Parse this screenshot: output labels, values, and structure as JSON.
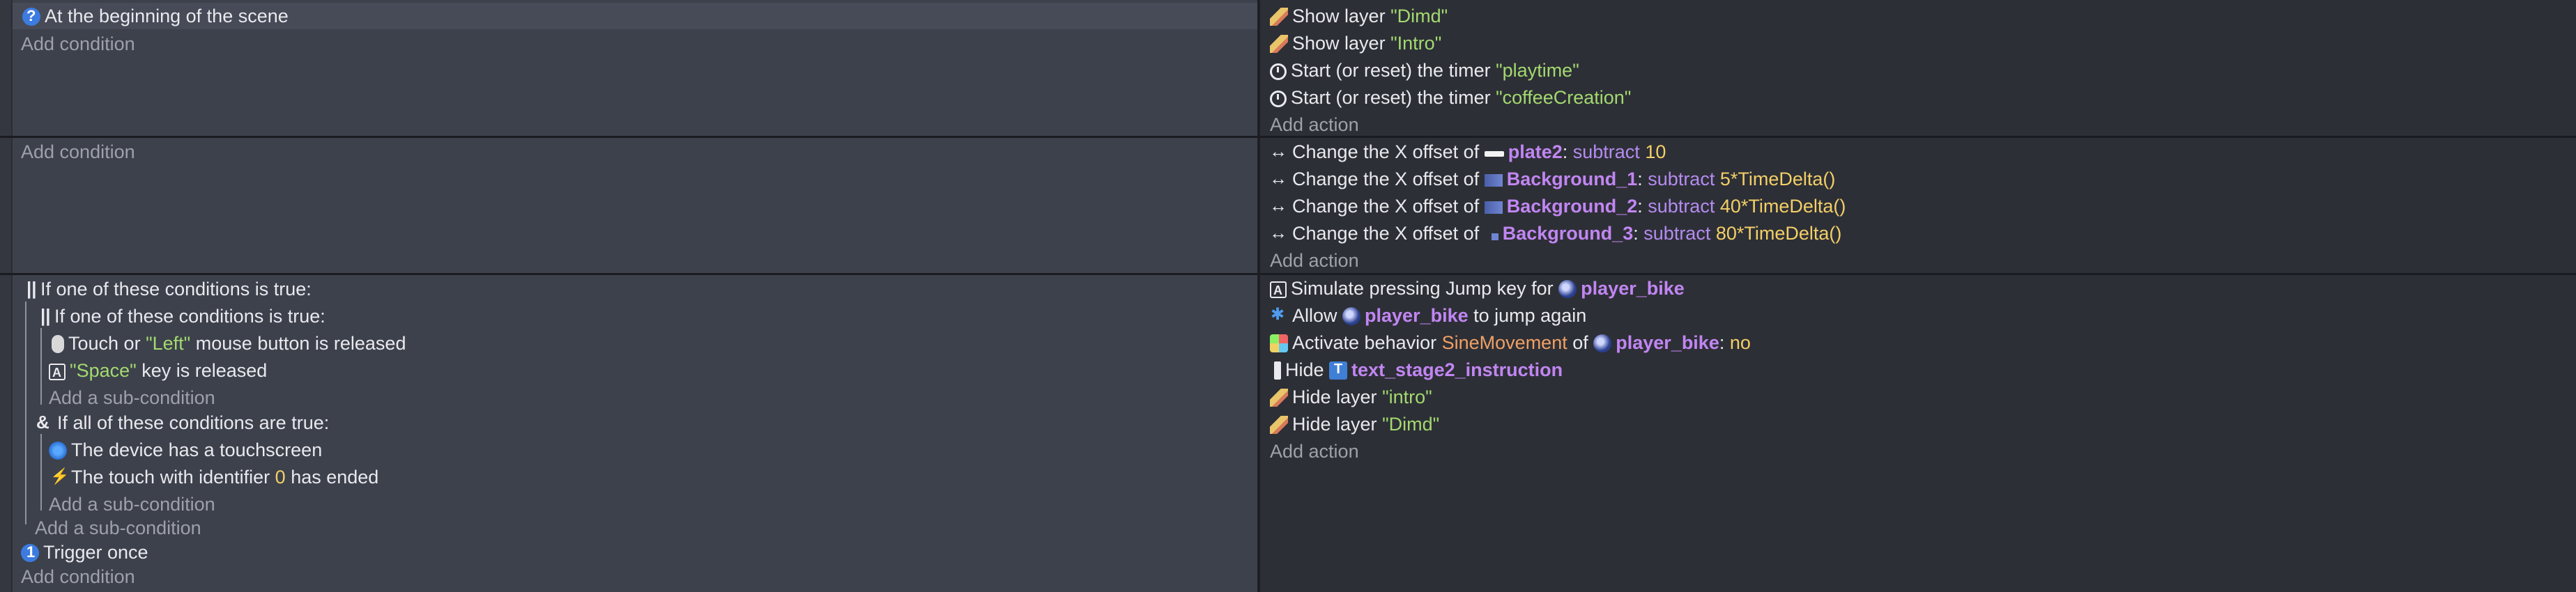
{
  "events": [
    {
      "conditions": [
        {
          "icon": "scene-start-icon",
          "text": "At the beginning of the scene"
        }
      ],
      "add_condition": "Add condition",
      "actions": [
        {
          "icon": "pencil-icon",
          "prefix": "Show layer ",
          "str": "\"Dimd\""
        },
        {
          "icon": "pencil-icon",
          "prefix": "Show layer ",
          "str": "\"Intro\""
        },
        {
          "icon": "timer-icon",
          "prefix": "Start (or reset) the timer ",
          "str": "\"playtime\""
        },
        {
          "icon": "timer-icon",
          "prefix": "Start (or reset) the timer ",
          "str": "\"coffeeCreation\""
        }
      ],
      "add_action": "Add action"
    },
    {
      "add_condition": "Add condition",
      "actions": [
        {
          "prefix": "Change the X offset of ",
          "object": "plate2",
          "op": "subtract",
          "value": "10"
        },
        {
          "prefix": "Change the X offset of ",
          "object": "Background_1",
          "op": "subtract",
          "value": "5*TimeDelta()"
        },
        {
          "prefix": "Change the X offset of ",
          "object": "Background_2",
          "op": "subtract",
          "value": "40*TimeDelta()"
        },
        {
          "prefix": "Change the X offset of ",
          "object": "Background_3",
          "op": "subtract",
          "value": "80*TimeDelta()"
        }
      ],
      "add_action": "Add action"
    },
    {
      "conditions": {
        "or_outer": "If one of these conditions is true:",
        "or_inner": "If one of these conditions is true:",
        "touch": {
          "prefix": "Touch or ",
          "str": "\"Left\"",
          "suffix": " mouse button is released"
        },
        "key": {
          "str": "\"Space\"",
          "suffix": " key is released"
        },
        "add_sub_inner": "Add a sub-condition",
        "and": "If all of these conditions are true:",
        "device": "The device has a touchscreen",
        "touch_ended": {
          "prefix": "The touch with identifier ",
          "num": "0",
          "suffix": " has ended"
        },
        "add_sub_and": "Add a sub-condition",
        "add_sub_outer": "Add a sub-condition",
        "trigger": "Trigger once"
      },
      "add_condition": "Add condition",
      "actions": {
        "simulate": {
          "prefix": "Simulate pressing Jump key for ",
          "object": "player_bike"
        },
        "allow": {
          "prefix": "Allow ",
          "object": "player_bike",
          "suffix": " to jump again"
        },
        "activate": {
          "prefix": "Activate behavior ",
          "behavior": "SineMovement",
          "mid": " of ",
          "object": "player_bike",
          "colon": ": ",
          "value": "no"
        },
        "hide": {
          "prefix": "Hide ",
          "object": "text_stage2_instruction"
        },
        "hide_layer_1": {
          "prefix": "Hide layer ",
          "str": "\"intro\""
        },
        "hide_layer_2": {
          "prefix": "Hide layer ",
          "str": "\"Dimd\""
        }
      },
      "add_action": "Add action"
    }
  ],
  "colors": {
    "string": "#a3d96f",
    "number": "#f2cf67",
    "object": "#c186f2",
    "operator": "#b48cf0",
    "behavior": "#f0a064"
  }
}
